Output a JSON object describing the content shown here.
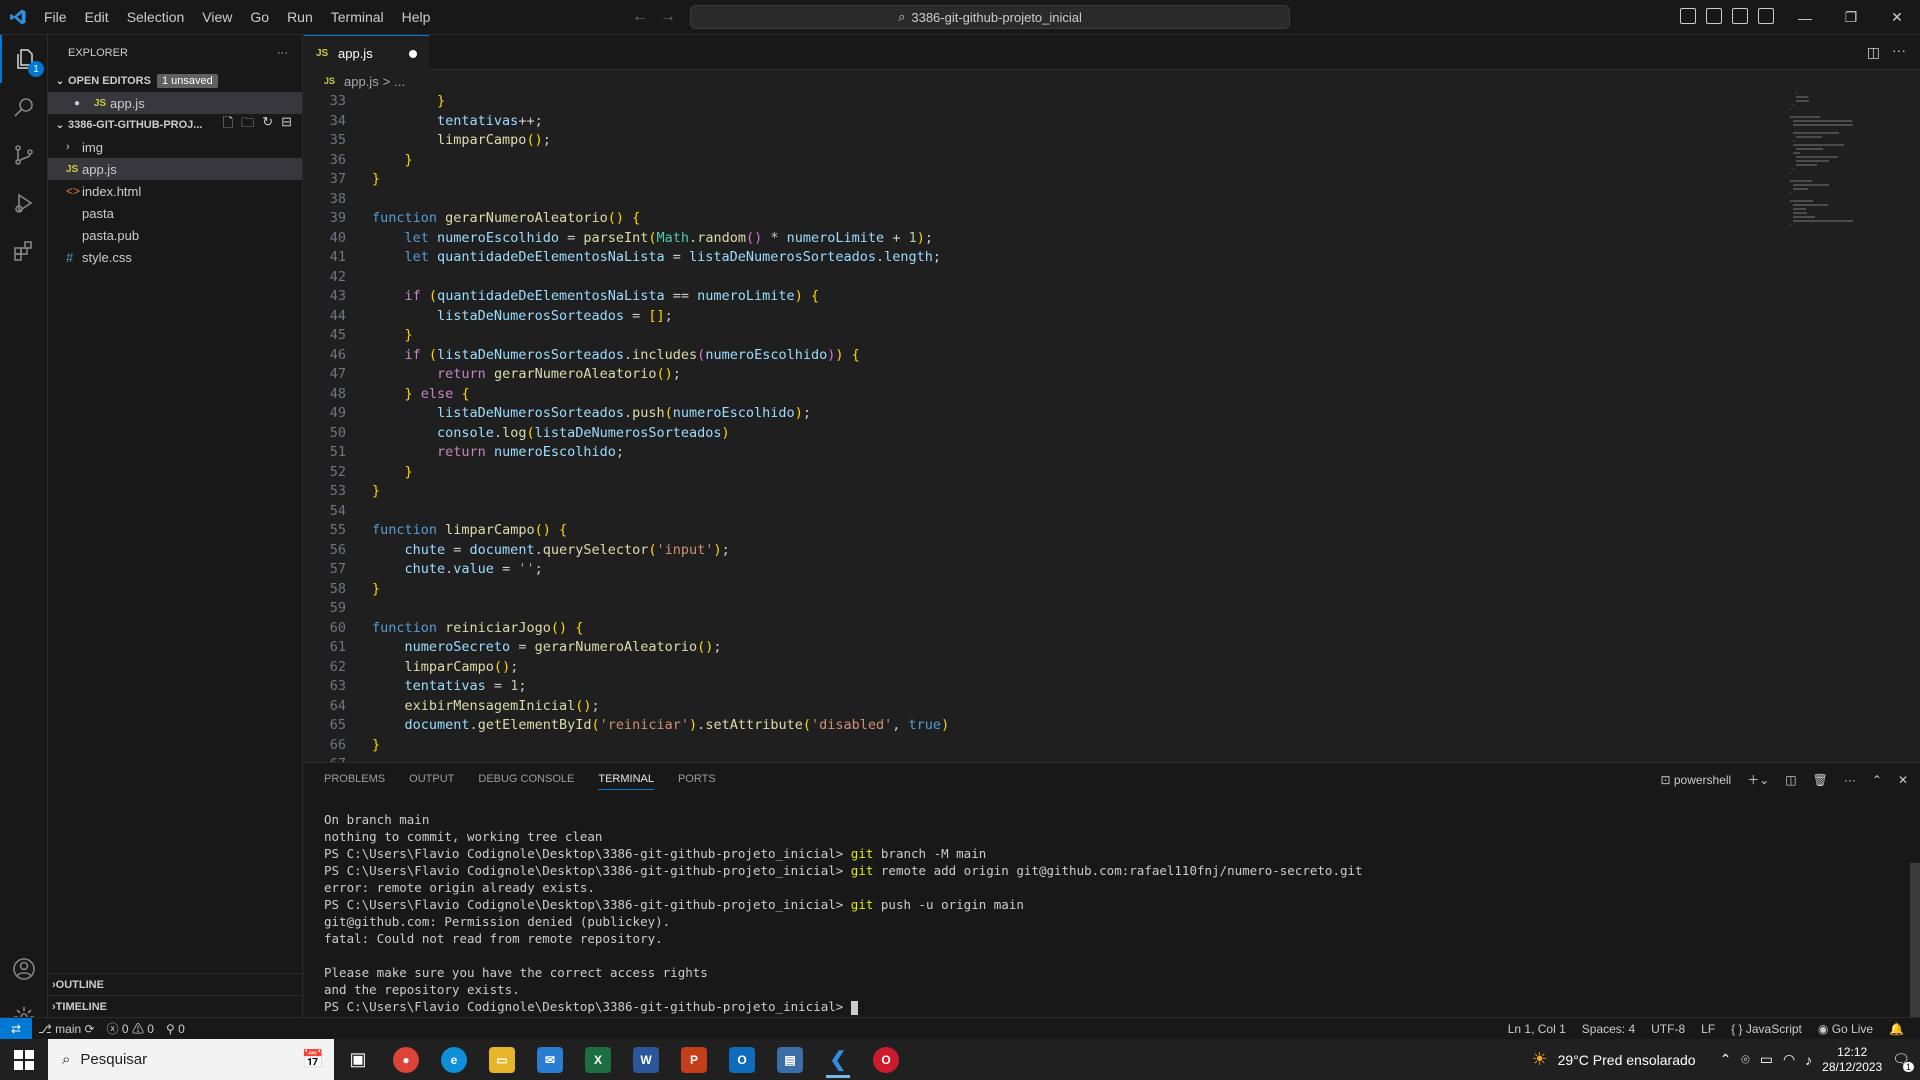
{
  "menu": [
    "File",
    "Edit",
    "Selection",
    "View",
    "Go",
    "Run",
    "Terminal",
    "Help"
  ],
  "command_center": "3386-git-github-projeto_inicial",
  "activity_badge": "1",
  "explorer": {
    "title": "EXPLORER",
    "more": "···",
    "open_editors_label": "OPEN EDITORS",
    "unsaved_badge": "1 unsaved",
    "open_editors": [
      {
        "name": "app.js"
      }
    ],
    "project_label": "3386-GIT-GITHUB-PROJ...",
    "files": [
      {
        "name": "img",
        "type": "folder"
      },
      {
        "name": "app.js",
        "type": "js"
      },
      {
        "name": "index.html",
        "type": "html"
      },
      {
        "name": "pasta",
        "type": "plain"
      },
      {
        "name": "pasta.pub",
        "type": "plain"
      },
      {
        "name": "style.css",
        "type": "css"
      }
    ],
    "outline_label": "OUTLINE",
    "timeline_label": "TIMELINE"
  },
  "tab": {
    "label": "app.js",
    "icon": "JS"
  },
  "breadcrumb": {
    "file": "app.js",
    "sep": ">",
    "rest": "..."
  },
  "code_lines": [
    {
      "n": "33",
      "text": "        }"
    },
    {
      "n": "34",
      "text": "        tentativas++;"
    },
    {
      "n": "35",
      "text": "        limparCampo();"
    },
    {
      "n": "36",
      "text": "    }"
    },
    {
      "n": "37",
      "text": "}"
    },
    {
      "n": "38",
      "text": ""
    },
    {
      "n": "39",
      "text": "function gerarNumeroAleatorio() {"
    },
    {
      "n": "40",
      "text": "    let numeroEscolhido = parseInt(Math.random() * numeroLimite + 1);"
    },
    {
      "n": "41",
      "text": "    let quantidadeDeElementosNaLista = listaDeNumerosSorteados.length;"
    },
    {
      "n": "42",
      "text": ""
    },
    {
      "n": "43",
      "text": "    if (quantidadeDeElementosNaLista == numeroLimite) {"
    },
    {
      "n": "44",
      "text": "        listaDeNumerosSorteados = [];"
    },
    {
      "n": "45",
      "text": "    }"
    },
    {
      "n": "46",
      "text": "    if (listaDeNumerosSorteados.includes(numeroEscolhido)) {"
    },
    {
      "n": "47",
      "text": "        return gerarNumeroAleatorio();"
    },
    {
      "n": "48",
      "text": "    } else {"
    },
    {
      "n": "49",
      "text": "        listaDeNumerosSorteados.push(numeroEscolhido);"
    },
    {
      "n": "50",
      "text": "        console.log(listaDeNumerosSorteados)"
    },
    {
      "n": "51",
      "text": "        return numeroEscolhido;"
    },
    {
      "n": "52",
      "text": "    }"
    },
    {
      "n": "53",
      "text": "}"
    },
    {
      "n": "54",
      "text": ""
    },
    {
      "n": "55",
      "text": "function limparCampo() {"
    },
    {
      "n": "56",
      "text": "    chute = document.querySelector('input');"
    },
    {
      "n": "57",
      "text": "    chute.value = '';"
    },
    {
      "n": "58",
      "text": "}"
    },
    {
      "n": "59",
      "text": ""
    },
    {
      "n": "60",
      "text": "function reiniciarJogo() {"
    },
    {
      "n": "61",
      "text": "    numeroSecreto = gerarNumeroAleatorio();"
    },
    {
      "n": "62",
      "text": "    limparCampo();"
    },
    {
      "n": "63",
      "text": "    tentativas = 1;"
    },
    {
      "n": "64",
      "text": "    exibirMensagemInicial();"
    },
    {
      "n": "65",
      "text": "    document.getElementById('reiniciar').setAttribute('disabled', true)"
    },
    {
      "n": "66",
      "text": "}"
    },
    {
      "n": "67",
      "text": ""
    }
  ],
  "panel": {
    "tabs": [
      "PROBLEMS",
      "OUTPUT",
      "DEBUG CONSOLE",
      "TERMINAL",
      "PORTS"
    ],
    "active_tab": "TERMINAL",
    "shell": "powershell"
  },
  "terminal_lines": [
    "On branch main",
    "nothing to commit, working tree clean",
    "PS C:\\Users\\Flavio Codignole\\Desktop\\3386-git-github-projeto_inicial> git branch -M main",
    "PS C:\\Users\\Flavio Codignole\\Desktop\\3386-git-github-projeto_inicial> git remote add origin git@github.com:rafael110fnj/numero-secreto.git",
    "error: remote origin already exists.",
    "PS C:\\Users\\Flavio Codignole\\Desktop\\3386-git-github-projeto_inicial> git push -u origin main",
    "git@github.com: Permission denied (publickey).",
    "fatal: Could not read from remote repository.",
    "",
    "Please make sure you have the correct access rights",
    "and the repository exists.",
    "PS C:\\Users\\Flavio Codignole\\Desktop\\3386-git-github-projeto_inicial> "
  ],
  "status": {
    "branch": "main",
    "errors": "0",
    "warnings": "0",
    "ports": "0",
    "position": "Ln 1, Col 1",
    "spaces": "Spaces: 4",
    "encoding": "UTF-8",
    "eol": "LF",
    "language": "JavaScript",
    "golive": "Go Live"
  },
  "taskbar": {
    "search_placeholder": "Pesquisar",
    "weather": "29°C  Pred ensolarado",
    "time": "12:12",
    "date": "28/12/2023",
    "notifications": "1"
  },
  "colors": {
    "accent": "#0078d4",
    "editor_bg": "#1f1f1f",
    "chrome_bg": "#181818"
  }
}
